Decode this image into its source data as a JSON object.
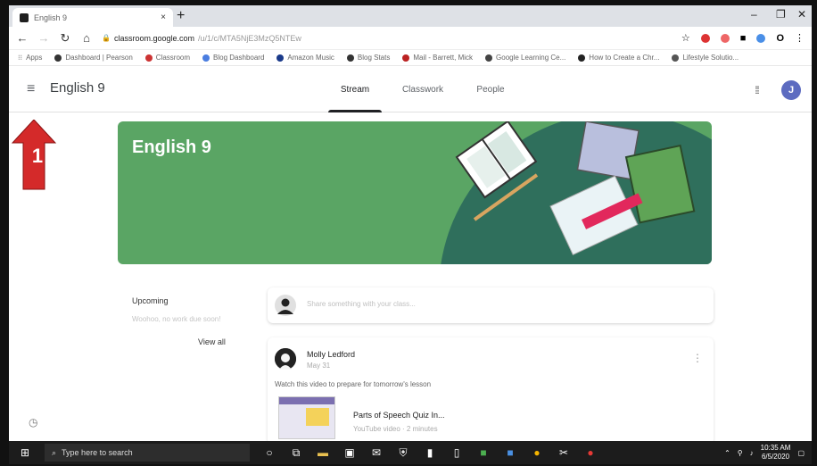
{
  "browser": {
    "tab_title": "English 9",
    "tab_close": "×",
    "new_tab": "+",
    "url_domain": "classroom.google.com",
    "url_path": "/u/1/c/MTA5NjE3MzQ5NTEw",
    "bookmarks": [
      "Apps",
      "Dashboard | Pearson",
      "Classroom",
      "Blog Dashboard",
      "Amazon Music",
      "Blog Stats",
      "Mail - Barrett, Mick",
      "Google Learning Ce...",
      "How to Create a Chr...",
      "Lifestyle Solutio..."
    ]
  },
  "classroom": {
    "class_name": "English 9",
    "tabs": [
      "Stream",
      "Classwork",
      "People"
    ],
    "active_tab": "Stream",
    "avatar_letter": "J",
    "banner_title": "English 9",
    "upcoming_label": "Upcoming",
    "upcoming_sub": "Woohoo, no work due soon!",
    "view_all": "View all",
    "announce_placeholder": "Share something with your class...",
    "post": {
      "author": "Molly Ledford",
      "date": "May 31",
      "text": "Watch this video to prepare for tomorrow's lesson",
      "video_title": "Parts of Speech Quiz In...",
      "video_sub": "YouTube video · 2 minutes"
    }
  },
  "annotation": {
    "number": "1",
    "color": "#d42a2a"
  },
  "taskbar": {
    "search_placeholder": "Type here to search",
    "time": "10:35 AM",
    "date": "6/5/2020"
  },
  "colors": {
    "banner": "#5aa564",
    "banner_dark": "#2f6f5c",
    "accent": "#5c6bc0"
  }
}
